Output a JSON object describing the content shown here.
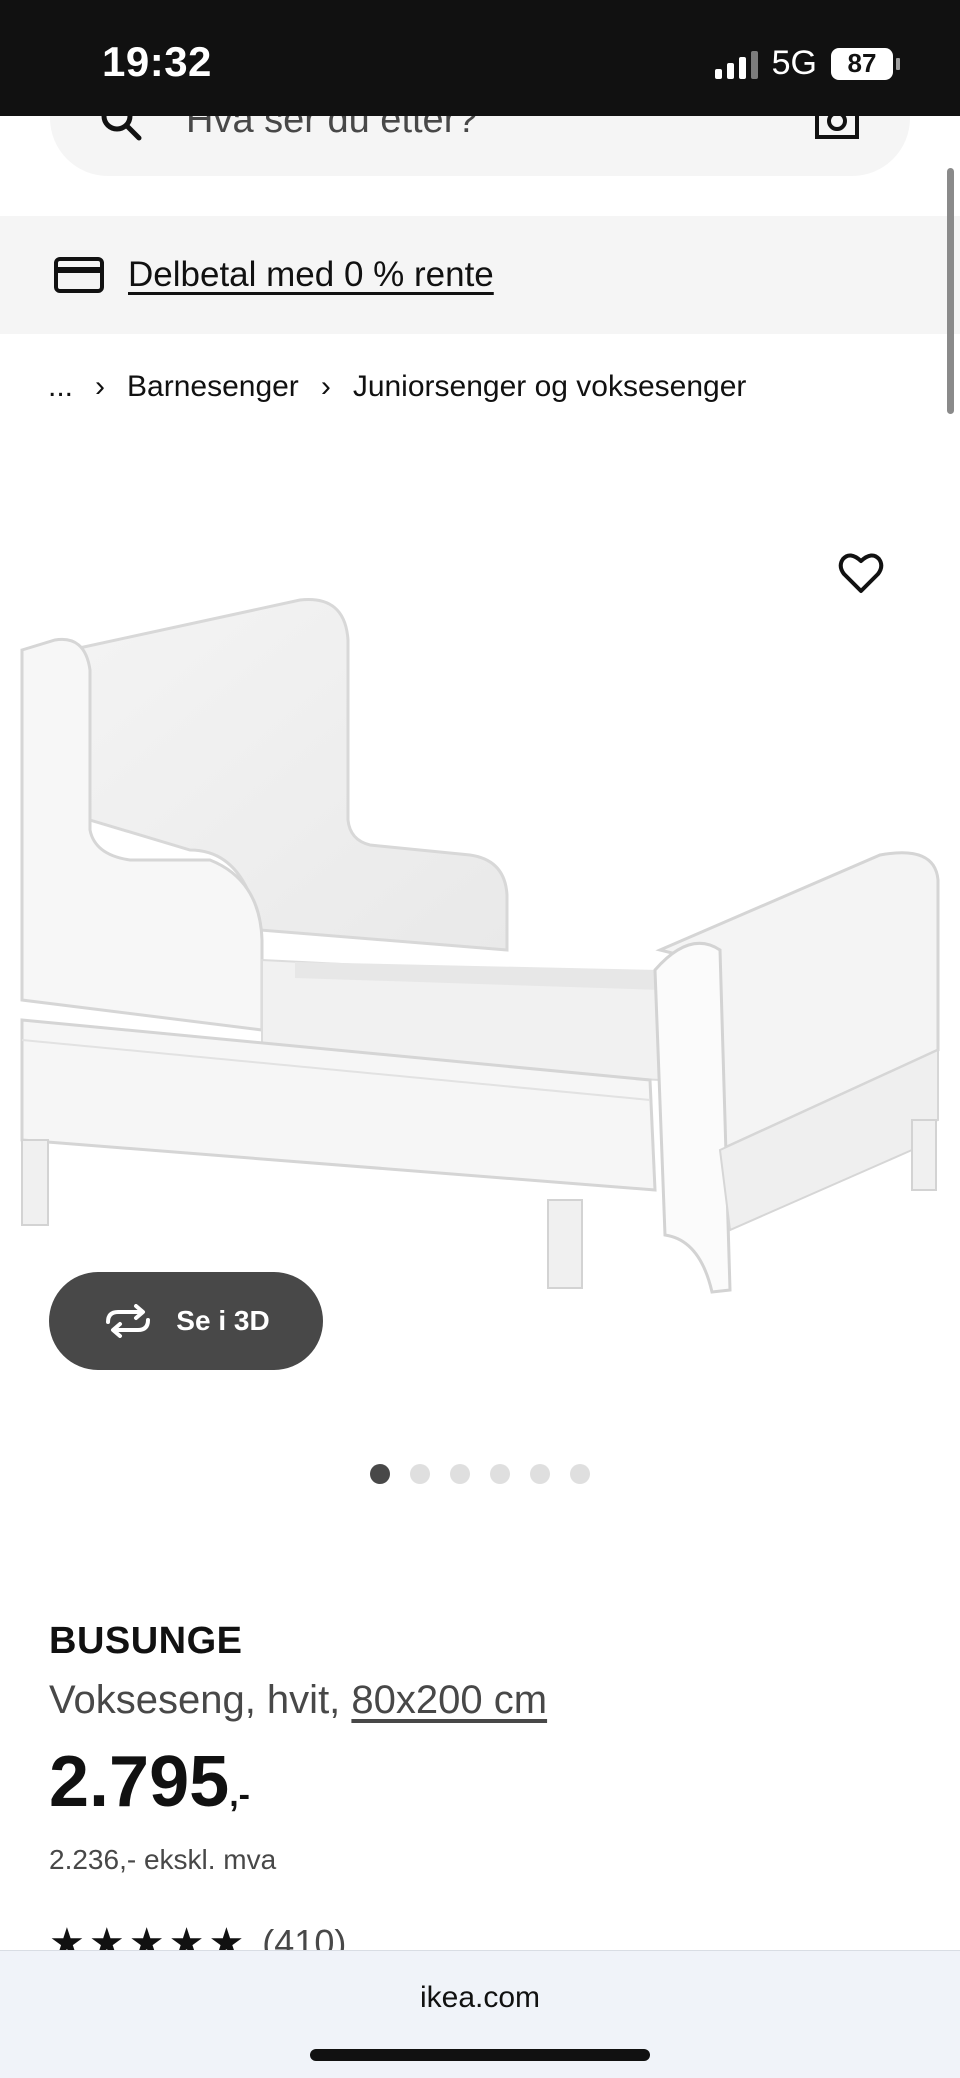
{
  "status_bar": {
    "time": "19:32",
    "network": "5G",
    "battery": "87"
  },
  "search": {
    "placeholder": "Hva ser du etter?",
    "search_icon": "search-icon",
    "camera_icon": "camera-icon"
  },
  "banner": {
    "icon": "credit-card-icon",
    "link_text": "Delbetal med 0 % rente"
  },
  "breadcrumb": {
    "items": [
      "...",
      "Barnesenger",
      "Juniorsenger og voksesenger"
    ]
  },
  "gallery": {
    "favorite_icon": "heart-icon",
    "see_3d_label": "Se i 3D",
    "dots_total": 6,
    "active_dot": 1
  },
  "product": {
    "name": "BUSUNGE",
    "description": "Vokseseng, hvit, ",
    "size": "80x200 cm",
    "price": "2.795",
    "price_suffix": ",-",
    "price_ex_vat": "2.236,- ekskl. mva",
    "rating_stars": "★★★★★",
    "review_count": "(410)"
  },
  "browser": {
    "url": "ikea.com"
  },
  "colors": {
    "status_bar_bg": "#111111",
    "pill_bg": "#484848",
    "banner_bg": "#f5f5f5"
  }
}
